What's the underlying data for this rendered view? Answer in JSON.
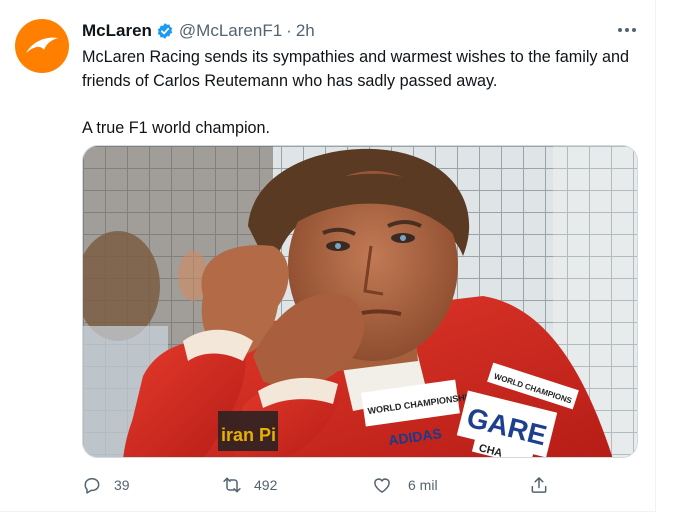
{
  "tweet": {
    "author_name": "McLaren",
    "handle": "@McLarenF1",
    "separator": "·",
    "time": "2h",
    "text_line1": "McLaren Racing sends its sympathies and warmest wishes to the family and friends of Carlos Reutemann who has sadly passed away.",
    "text_line2": "A true F1 world champion."
  },
  "media": {
    "jacket_texts": {
      "brand_left": "iran Pi",
      "patch_world": "WORLD CHAMPIONSHIP",
      "patch_adidas": "ADIDAS",
      "patch_world2": "WORLD CHAMPIONS",
      "patch_gare": "GARE",
      "patch_cha": "CHA"
    }
  },
  "actions": {
    "reply_count": "39",
    "retweet_count": "492",
    "like_count": "6 mil"
  },
  "colors": {
    "brand": "#ff8000",
    "verified": "#1d9bf0",
    "secondary_text": "#536471"
  },
  "icons": [
    "mclaren-logo-icon",
    "verified-badge-icon",
    "more-icon",
    "reply-icon",
    "retweet-icon",
    "like-icon",
    "share-icon"
  ]
}
